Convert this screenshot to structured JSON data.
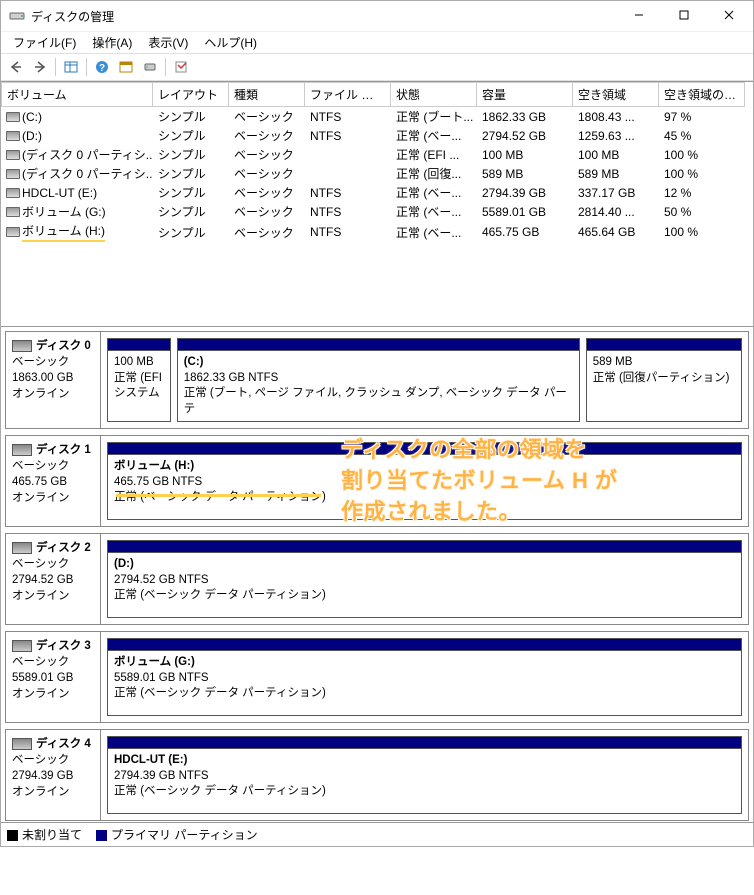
{
  "title": "ディスクの管理",
  "menu": {
    "file": "ファイル(F)",
    "action": "操作(A)",
    "view": "表示(V)",
    "help": "ヘルプ(H)"
  },
  "columns": {
    "volume": "ボリューム",
    "layout": "レイアウト",
    "type": "種類",
    "fs": "ファイル システム",
    "status": "状態",
    "capacity": "容量",
    "free": "空き領域",
    "pct": "空き領域の割..."
  },
  "rows": [
    {
      "vol": "(C:)",
      "layout": "シンプル",
      "type": "ベーシック",
      "fs": "NTFS",
      "status": "正常 (ブート...",
      "cap": "1862.33 GB",
      "free": "1808.43 ...",
      "pct": "97 %"
    },
    {
      "vol": "(D:)",
      "layout": "シンプル",
      "type": "ベーシック",
      "fs": "NTFS",
      "status": "正常 (ベー...",
      "cap": "2794.52 GB",
      "free": "1259.63 ...",
      "pct": "45 %"
    },
    {
      "vol": "(ディスク 0 パーティシ...",
      "layout": "シンプル",
      "type": "ベーシック",
      "fs": "",
      "status": "正常 (EFI ...",
      "cap": "100 MB",
      "free": "100 MB",
      "pct": "100 %"
    },
    {
      "vol": "(ディスク 0 パーティシ...",
      "layout": "シンプル",
      "type": "ベーシック",
      "fs": "",
      "status": "正常 (回復...",
      "cap": "589 MB",
      "free": "589 MB",
      "pct": "100 %"
    },
    {
      "vol": "HDCL-UT (E:)",
      "layout": "シンプル",
      "type": "ベーシック",
      "fs": "NTFS",
      "status": "正常 (ベー...",
      "cap": "2794.39 GB",
      "free": "337.17 GB",
      "pct": "12 %"
    },
    {
      "vol": "ボリューム (G:)",
      "layout": "シンプル",
      "type": "ベーシック",
      "fs": "NTFS",
      "status": "正常 (ベー...",
      "cap": "5589.01 GB",
      "free": "2814.40 ...",
      "pct": "50 %"
    },
    {
      "vol": "ボリューム (H:)",
      "layout": "シンプル",
      "type": "ベーシック",
      "fs": "NTFS",
      "status": "正常 (ベー...",
      "cap": "465.75 GB",
      "free": "465.64 GB",
      "pct": "100 %"
    }
  ],
  "disks": [
    {
      "name": "ディスク 0",
      "type": "ベーシック",
      "size": "1863.00 GB",
      "state": "オンライン",
      "parts": [
        {
          "title": "",
          "size": "100 MB",
          "status": "正常 (EFI システム",
          "flex": 10
        },
        {
          "title": "(C:)",
          "size": "1862.33 GB NTFS",
          "status": "正常 (ブート, ページ ファイル, クラッシュ ダンプ, ベーシック データ パーテ",
          "flex": 65
        },
        {
          "title": "",
          "size": "589 MB",
          "status": "正常 (回復パーティション)",
          "flex": 25
        }
      ]
    },
    {
      "name": "ディスク 1",
      "type": "ベーシック",
      "size": "465.75 GB",
      "state": "オンライン",
      "parts": [
        {
          "title": "ボリューム  (H:)",
          "size": "465.75 GB NTFS",
          "status": "正常 (ベーシック データ パーティション)",
          "flex": 100
        }
      ]
    },
    {
      "name": "ディスク 2",
      "type": "ベーシック",
      "size": "2794.52 GB",
      "state": "オンライン",
      "parts": [
        {
          "title": "(D:)",
          "size": "2794.52 GB NTFS",
          "status": "正常 (ベーシック データ パーティション)",
          "flex": 100
        }
      ]
    },
    {
      "name": "ディスク 3",
      "type": "ベーシック",
      "size": "5589.01 GB",
      "state": "オンライン",
      "parts": [
        {
          "title": "ボリューム  (G:)",
          "size": "5589.01 GB NTFS",
          "status": "正常 (ベーシック データ パーティション)",
          "flex": 100
        }
      ]
    },
    {
      "name": "ディスク 4",
      "type": "ベーシック",
      "size": "2794.39 GB",
      "state": "オンライン",
      "parts": [
        {
          "title": "HDCL-UT  (E:)",
          "size": "2794.39 GB NTFS",
          "status": "正常 (ベーシック データ パーティション)",
          "flex": 100
        }
      ]
    }
  ],
  "overlay": {
    "line1": "ディスクの全部の領域を",
    "line2": "割り当てたボリューム H が",
    "line3": "作成されました。"
  },
  "legend": {
    "unalloc": "未割り当て",
    "primary": "プライマリ パーティション"
  }
}
